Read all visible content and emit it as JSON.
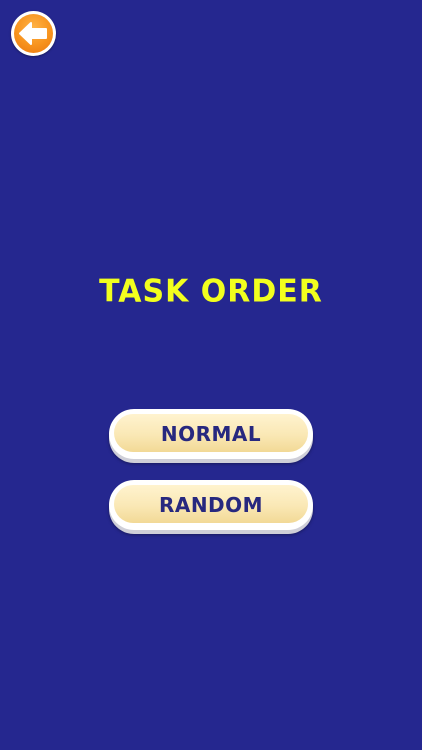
{
  "header": {
    "back_icon": "arrow-left-icon"
  },
  "screen": {
    "title": "TASK ORDER"
  },
  "menu": {
    "normal_label": "NORMAL",
    "random_label": "RANDOM"
  },
  "colors": {
    "background": "#25278f",
    "title": "#f2ff1e",
    "button_fill": "#fae8b5",
    "button_text": "#27287f",
    "back_button": "#f7931e"
  }
}
